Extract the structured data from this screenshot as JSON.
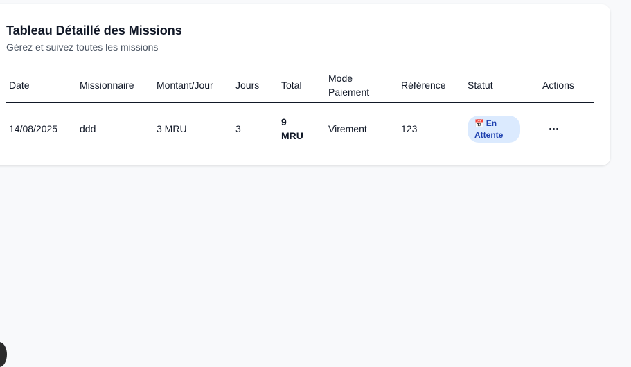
{
  "card": {
    "title": "Tableau Détaillé des Missions",
    "subtitle": "Gérez et suivez toutes les missions"
  },
  "table": {
    "headers": {
      "date": "Date",
      "missionnaire": "Missionnaire",
      "montant_jour": "Montant/Jour",
      "jours": "Jours",
      "total": "Total",
      "mode_paiement_line1": "Mode",
      "mode_paiement_line2": "Paiement",
      "reference": "Référence",
      "statut": "Statut",
      "actions": "Actions"
    },
    "rows": [
      {
        "date": "14/08/2025",
        "missionnaire": "ddd",
        "montant_jour": "3 MRU",
        "jours": "3",
        "total_line1": "9",
        "total_line2": "MRU",
        "mode_paiement": "Virement",
        "reference": "123",
        "statut_icon": "📅",
        "statut_line1": "En",
        "statut_line2": "Attente"
      }
    ]
  },
  "colors": {
    "badge_bg": "#dbeafe",
    "badge_text": "#1e40af",
    "page_bg": "#f8f9fb"
  }
}
